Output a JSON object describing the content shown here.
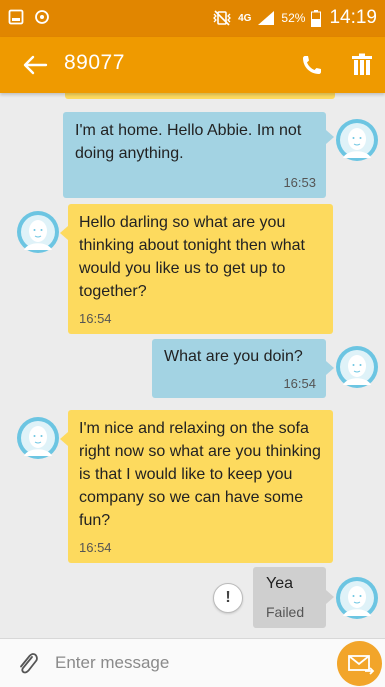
{
  "status_bar": {
    "network_label": "4G",
    "battery_percent": "52%",
    "time": "14:19",
    "color": "#e18600"
  },
  "header": {
    "contact": "89077",
    "color": "#ef9a00",
    "icons": [
      "back-arrow-icon",
      "phone-icon",
      "trash-icon"
    ]
  },
  "messages": [
    {
      "direction": "outgoing",
      "text": "I'm at home. Hello Abbie. Im not doing anything.",
      "time": "16:53",
      "color": "#a3d3e3"
    },
    {
      "direction": "incoming",
      "text": "Hello darling so what are you thinking about tonight then what would you like us to get up to together?",
      "time": "16:54",
      "color": "#fdda5e"
    },
    {
      "direction": "outgoing",
      "text": "What are you doin?",
      "time": "16:54",
      "color": "#a3d3e3"
    },
    {
      "direction": "incoming",
      "text": "I'm nice and relaxing on the sofa right now so what are you thinking is that I would like to keep you company so we can have some fun?",
      "time": "16:54",
      "color": "#fdda5e"
    },
    {
      "direction": "outgoing",
      "text": "Yea",
      "status": "Failed",
      "color": "#cfcfcf"
    }
  ],
  "composer": {
    "placeholder": "Enter message",
    "send_color": "#f2a52a"
  }
}
